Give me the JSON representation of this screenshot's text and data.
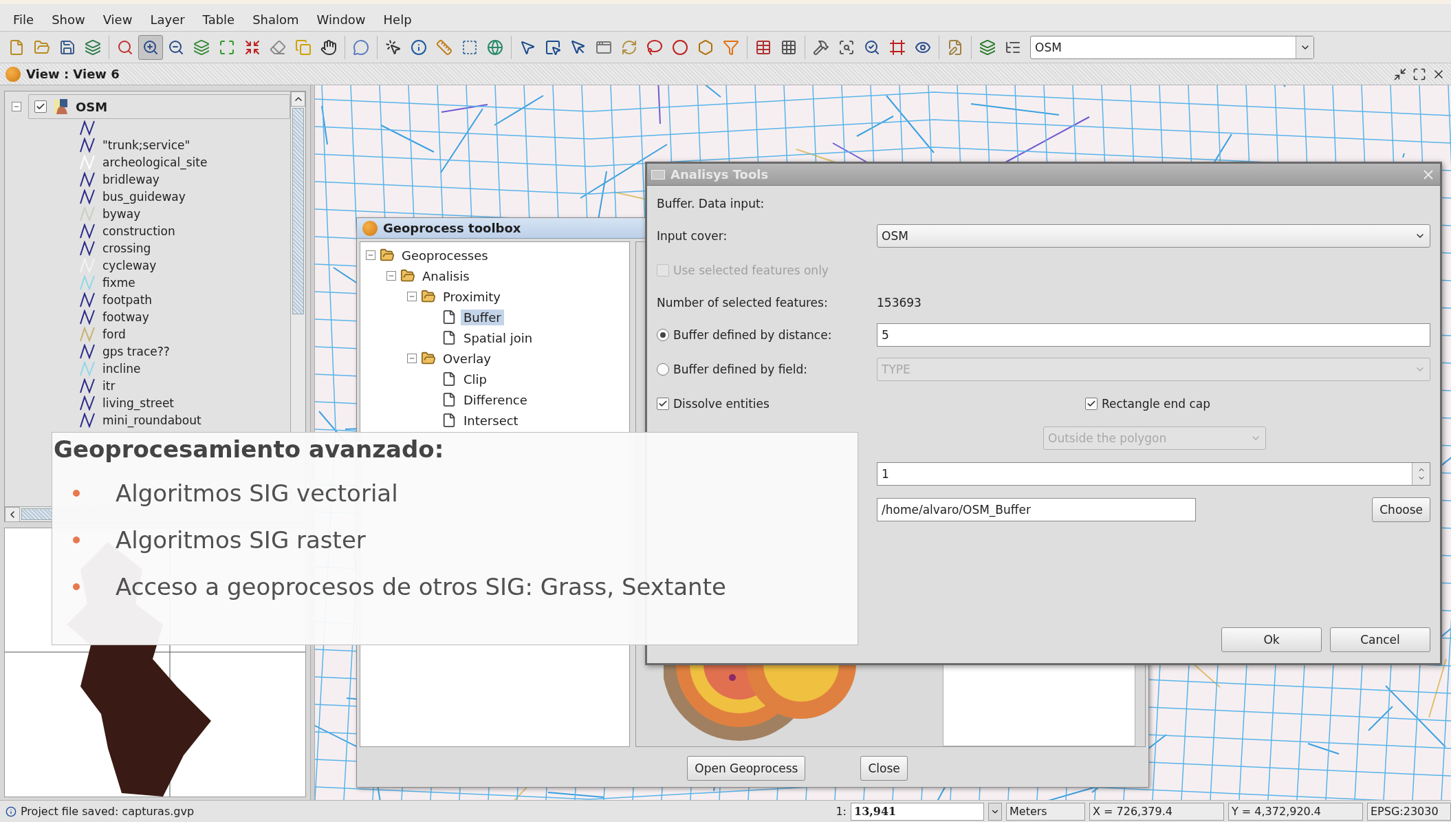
{
  "menu": [
    "File",
    "Show",
    "View",
    "Layer",
    "Table",
    "Shalom",
    "Window",
    "Help"
  ],
  "toolbar": {
    "tools": [
      {
        "selected": false
      },
      {
        "selected": false
      },
      {
        "selected": false
      },
      {
        "selected": false
      },
      {
        "selected": false
      },
      {
        "selected": true
      },
      {
        "selected": false
      },
      {
        "selected": false
      },
      {
        "selected": false
      },
      {
        "selected": false
      },
      {
        "selected": false
      },
      {
        "selected": false
      },
      {
        "selected": false
      },
      {
        "selected": false
      },
      {
        "selected": false
      },
      {
        "selected": false
      },
      {
        "selected": false
      },
      {
        "selected": false
      },
      {
        "selected": false
      },
      {
        "selected": false
      },
      {
        "selected": false
      },
      {
        "selected": false
      },
      {
        "selected": false
      },
      {
        "selected": false
      },
      {
        "selected": false
      },
      {
        "selected": false
      },
      {
        "selected": false
      },
      {
        "selected": false
      },
      {
        "selected": false
      },
      {
        "selected": false
      },
      {
        "selected": false
      },
      {
        "selected": false
      },
      {
        "selected": false
      },
      {
        "selected": false
      },
      {
        "selected": false
      },
      {
        "selected": false
      },
      {
        "selected": false
      },
      {
        "selected": false
      }
    ],
    "layer_combo": "OSM"
  },
  "view": {
    "title": "View : View 6"
  },
  "toc": {
    "layer": {
      "label": "OSM",
      "checked": true,
      "expanded": true
    },
    "legend": [
      {
        "color": "#2a2a8a"
      },
      {
        "label": "\"trunk;service\"",
        "color": "#2a2a8a"
      },
      {
        "label": "archeological_site",
        "color": "#ffffff"
      },
      {
        "label": "bridleway",
        "color": "#2a2a8a"
      },
      {
        "label": "bus_guideway",
        "color": "#2a2a8a"
      },
      {
        "label": "byway",
        "color": "#c8d0c0"
      },
      {
        "label": "construction",
        "color": "#2a2a8a"
      },
      {
        "label": "crossing",
        "color": "#2a2a8a"
      },
      {
        "label": "cycleway",
        "color": "#f4f4f4"
      },
      {
        "label": "fixme",
        "color": "#8ed8e8"
      },
      {
        "label": "footpath",
        "color": "#2a2a8a"
      },
      {
        "label": "footway",
        "color": "#2a2a8a"
      },
      {
        "label": "ford",
        "color": "#c8b070"
      },
      {
        "label": "gps trace??",
        "color": "#2a2a8a"
      },
      {
        "label": "incline",
        "color": "#8ed8e8"
      },
      {
        "label": "itr",
        "color": "#2a2a8a"
      },
      {
        "label": "living_street",
        "color": "#2a2a8a"
      },
      {
        "label": "mini_roundabout",
        "color": "#2a2a8a"
      }
    ]
  },
  "toolbox": {
    "title": "Geoprocess toolbox",
    "tree": [
      {
        "kind": "folder",
        "label": "Geoprocesses",
        "expanded": true,
        "children": [
          {
            "kind": "folder",
            "label": "Analisis",
            "expanded": true,
            "children": [
              {
                "kind": "folder",
                "label": "Proximity",
                "expanded": true,
                "children": [
                  {
                    "kind": "process",
                    "label": "Buffer",
                    "selected": true
                  },
                  {
                    "kind": "process",
                    "label": "Spatial join",
                    "selected": false
                  }
                ]
              },
              {
                "kind": "folder",
                "label": "Overlay",
                "expanded": true,
                "children": [
                  {
                    "kind": "process",
                    "label": "Clip",
                    "selected": false
                  },
                  {
                    "kind": "process",
                    "label": "Difference",
                    "selected": false
                  },
                  {
                    "kind": "process",
                    "label": "Intersect",
                    "selected": false
                  }
                ]
              }
            ]
          }
        ]
      }
    ],
    "buttons": [
      "Open Geoprocess",
      "Close"
    ]
  },
  "dialog": {
    "title": "Analisys Tools",
    "heading": "Buffer. Data input:",
    "input_cover": {
      "label": "Input cover:",
      "value": "OSM"
    },
    "use_selected": {
      "label": "Use selected features only",
      "checked": false,
      "disabled": true
    },
    "selected_count": {
      "label": "Number of selected features:",
      "value": "153693"
    },
    "by_distance": {
      "label": "Buffer defined by distance:",
      "selected": true,
      "value": "5"
    },
    "by_field": {
      "label": "Buffer defined by field:",
      "selected": false,
      "value": "TYPE",
      "disabled": true
    },
    "dissolve": {
      "label": "Dissolve entities",
      "checked": true
    },
    "end_cap": {
      "label": "Rectangle end cap",
      "checked": true
    },
    "create_buffer": {
      "value": "Outside the polygon",
      "disabled": true
    },
    "radial_buffers": {
      "value": "1"
    },
    "output_cover": {
      "value": "/home/alvaro/OSM_Buffer",
      "button": "Choose"
    },
    "buttons": [
      "Ok",
      "Cancel"
    ]
  },
  "slide": {
    "heading": "Geoprocesamiento avanzado:",
    "bullets": [
      "Algoritmos SIG vectorial",
      "Algoritmos SIG raster",
      "Acceso a geoprocesos de otros SIG: Grass, Sextante"
    ]
  },
  "status_bar": {
    "message": "Project file saved: capturas.gvp",
    "scale_prefix": "1:",
    "scale": "13,941",
    "units": "Meters",
    "x": "X = 726,379.4",
    "y": "Y = 4,372,920.4",
    "crs": "EPSG:23030"
  }
}
